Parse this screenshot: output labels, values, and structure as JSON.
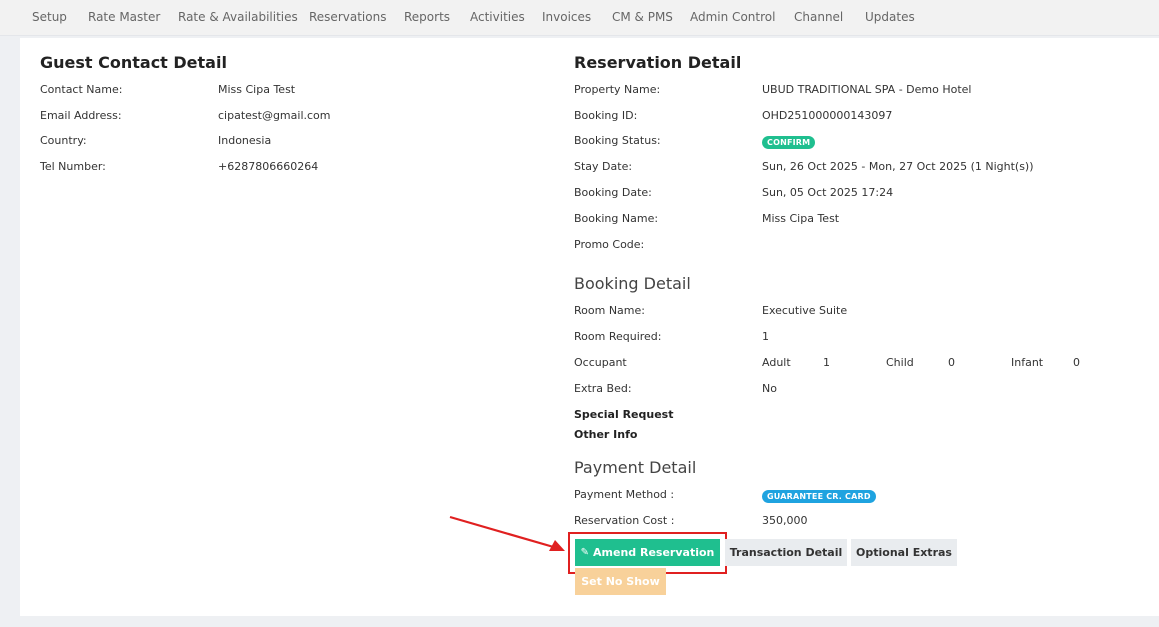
{
  "nav": {
    "items": [
      "Setup",
      "Rate Master",
      "Rate & Availabilities",
      "Reservations",
      "Reports",
      "Activities",
      "Invoices",
      "CM & PMS",
      "Admin Control",
      "Channel",
      "Updates"
    ]
  },
  "guest": {
    "title": "Guest Contact Detail",
    "rows": [
      {
        "label": "Contact Name:",
        "value": "Miss Cipa Test"
      },
      {
        "label": "Email Address:",
        "value": "cipatest@gmail.com"
      },
      {
        "label": "Country:",
        "value": "Indonesia"
      },
      {
        "label": "Tel Number:",
        "value": "+6287806660264"
      }
    ]
  },
  "reservation": {
    "title": "Reservation Detail",
    "property_label": "Property Name:",
    "property_value": "UBUD TRADITIONAL SPA - Demo Hotel",
    "booking_id_label": "Booking ID:",
    "booking_id_value": "OHD251000000143097",
    "status_label": "Booking Status:",
    "status_value": "CONFIRM",
    "stay_label": "Stay Date:",
    "stay_value": "Sun, 26 Oct 2025 - Mon, 27 Oct 2025 (1 Night(s))",
    "booking_date_label": "Booking Date:",
    "booking_date_value": "Sun, 05 Oct 2025 17:24",
    "booking_name_label": "Booking Name:",
    "booking_name_value": "Miss Cipa Test",
    "promo_label": "Promo Code:",
    "promo_value": ""
  },
  "booking": {
    "title": "Booking Detail",
    "room_name_label": "Room Name:",
    "room_name_value": "Executive Suite",
    "room_required_label": "Room Required:",
    "room_required_value": "1",
    "occupant_label": "Occupant",
    "adult_label": "Adult",
    "adult_value": "1",
    "child_label": "Child",
    "child_value": "0",
    "infant_label": "Infant",
    "infant_value": "0",
    "extra_bed_label": "Extra Bed:",
    "extra_bed_value": "No",
    "special_request_label": "Special Request",
    "other_info_label": "Other Info"
  },
  "payment": {
    "title": "Payment Detail",
    "method_label": "Payment Method :",
    "method_value": "GUARANTEE CR. CARD",
    "cost_label": "Reservation Cost :",
    "cost_value": "350,000"
  },
  "actions": {
    "amend": "Amend Reservation",
    "transaction": "Transaction Detail",
    "extras": "Optional Extras",
    "no_show": "Set No Show"
  },
  "colors": {
    "accent_green": "#1fbf8f",
    "badge_blue": "#1fa3e0",
    "highlight_red": "#e02020",
    "no_show_orange": "#f8d19a"
  }
}
